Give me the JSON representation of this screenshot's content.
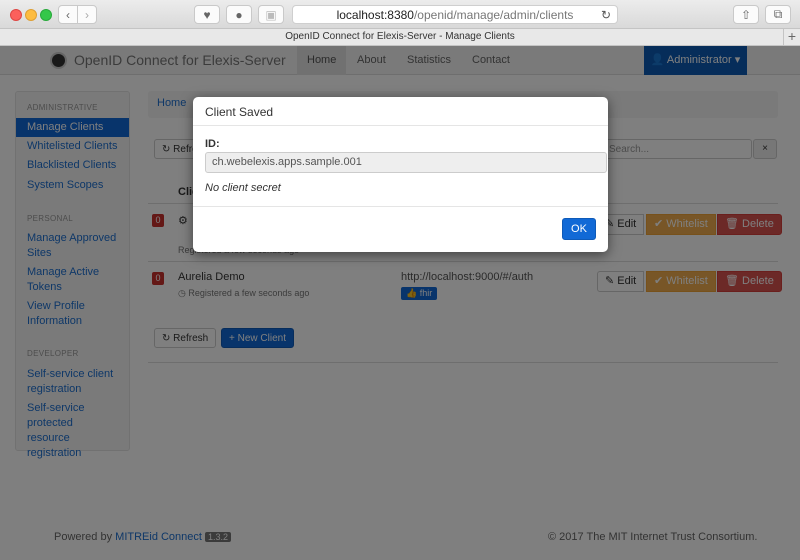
{
  "browser": {
    "url_host": "localhost:8380",
    "url_path": "/openid/manage/admin/clients",
    "tab_title": "OpenID Connect for Elexis-Server - Manage Clients"
  },
  "navbar": {
    "brand": "OpenID Connect for Elexis-Server",
    "items": [
      "Home",
      "About",
      "Statistics",
      "Contact"
    ],
    "user": "Administrator"
  },
  "sidebar": {
    "administrative_header": "ADMINISTRATIVE",
    "administrative": [
      "Manage Clients",
      "Whitelisted Clients",
      "Blacklisted Clients",
      "System Scopes"
    ],
    "personal_header": "PERSONAL",
    "personal": [
      [
        "Manage Approved",
        "Sites"
      ],
      [
        "Manage Active",
        "Tokens"
      ],
      [
        "View Profile",
        "Information"
      ]
    ],
    "developer_header": "DEVELOPER",
    "developer": [
      [
        "Self-service client",
        "registration"
      ],
      [
        "Self-service",
        "protected resource",
        "registration"
      ]
    ]
  },
  "main": {
    "breadcrumb": "Home",
    "refresh_label": "Refresh",
    "new_client_label": "New Client",
    "search_placeholder": "Search...",
    "client_column": "Client",
    "rows": [
      {
        "count": "0",
        "name": "",
        "meta": "Registered a few seconds ago",
        "url": "",
        "scope": ""
      },
      {
        "count": "0",
        "name": "Aurelia Demo",
        "meta": "Registered a few seconds ago",
        "url": "http://localhost:9000/#/auth",
        "scope": "fhir"
      }
    ],
    "edit_label": "Edit",
    "whitelist_label": "Whitelist",
    "delete_label": "Delete"
  },
  "footer": {
    "powered_by": "Powered by",
    "link": "MITREid Connect",
    "version": "1.3.2",
    "copyright": "© 2017 The MIT Internet Trust Consortium."
  },
  "modal": {
    "title": "Client Saved",
    "id_label": "ID:",
    "id_value": "ch.webelexis.apps.sample.001",
    "secret_note": "No client secret",
    "ok_label": "OK"
  },
  "colors": {
    "primary": "#1169d6",
    "danger": "#d9534f",
    "warning": "#f0ad4e",
    "backdrop": "rgba(0,0,0,0.5)"
  }
}
